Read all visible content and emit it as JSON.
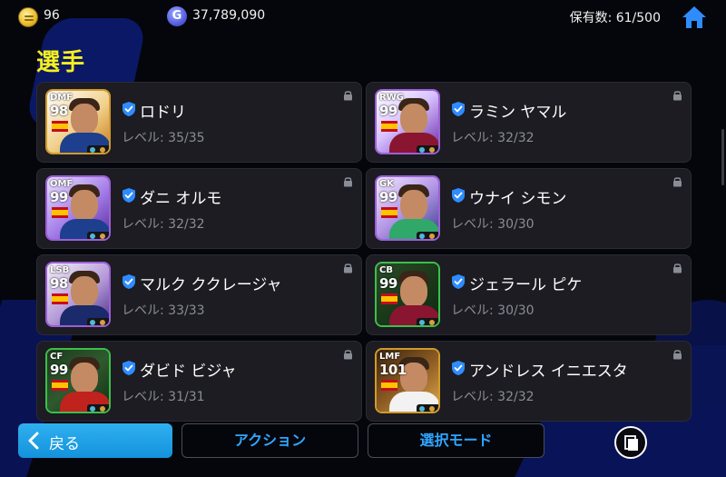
{
  "header": {
    "coins": "96",
    "gp": "37,789,090",
    "owned_count": "保有数: 61/500"
  },
  "title": "選手",
  "players": [
    {
      "position": "DMF",
      "rating": "98",
      "name": "ロドリ",
      "level": "レベル: 35/35",
      "frame": "#d29a2a",
      "bg": "linear-gradient(140deg,#ffffff,#f0d08a 55%,#c87c1e)",
      "kit": "#1d3f8e"
    },
    {
      "position": "RWG",
      "rating": "99",
      "name": "ラミン ヤマル",
      "level": "レベル: 32/32",
      "frame": "#9c5fd8",
      "bg": "linear-gradient(140deg,#ffffff,#d8c2ff 45%,#6a2aa8)",
      "kit": "#8a1530"
    },
    {
      "position": "OMF",
      "rating": "99",
      "name": "ダニ オルモ",
      "level": "レベル: 32/32",
      "frame": "#9c5fd8",
      "bg": "linear-gradient(140deg,#e8e0ff,#a37ce8 55%,#5a2a9e)",
      "kit": "#1d3f8e"
    },
    {
      "position": "GK",
      "rating": "99",
      "name": "ウナイ シモン",
      "level": "レベル: 30/30",
      "frame": "#9c5fd8",
      "bg": "linear-gradient(140deg,#f2e8ff,#b497e6 50%,#3a3b8e)",
      "kit": "#2fa86a"
    },
    {
      "position": "LSB",
      "rating": "98",
      "name": "マルク ククレージャ",
      "level": "レベル: 33/33",
      "frame": "#9c5fd8",
      "bg": "linear-gradient(140deg,#f5eefa,#b49ad8 55%,#4e2e8a)",
      "kit": "#1a2a6a"
    },
    {
      "position": "CB",
      "rating": "99",
      "name": "ジェラール ピケ",
      "level": "レベル: 30/30",
      "frame": "#3cbf4a",
      "bg": "linear-gradient(140deg,#2a4a2a,#1a3a1a 50%,#0f2a12)",
      "kit": "#8a1530"
    },
    {
      "position": "CF",
      "rating": "99",
      "name": "ダビド ビジャ",
      "level": "レベル: 31/31",
      "frame": "#3cbf4a",
      "bg": "linear-gradient(140deg,#1e3a1e,#2e5a2e 50%,#143014)",
      "kit": "#c0221e"
    },
    {
      "position": "LMF",
      "rating": "101",
      "name": "アンドレス イニエスタ",
      "level": "レベル: 32/32",
      "frame": "#d29a2a",
      "bg": "linear-gradient(140deg,#3a2410,#8a5a22 50%,#e0a84a)",
      "kit": "#f2f2f2"
    }
  ],
  "footer": {
    "back_label": "戻る",
    "action_label": "アクション",
    "select_mode_label": "選択モード"
  },
  "colors": {
    "accent": "#2fa6ff",
    "title": "#f6ef1f",
    "card": "#1c1c22"
  },
  "icons": [
    "coin-icon",
    "gp-icon",
    "home-icon",
    "verified-icon",
    "lock-icon",
    "flag-icon",
    "chevron-left-icon",
    "document-icon"
  ]
}
